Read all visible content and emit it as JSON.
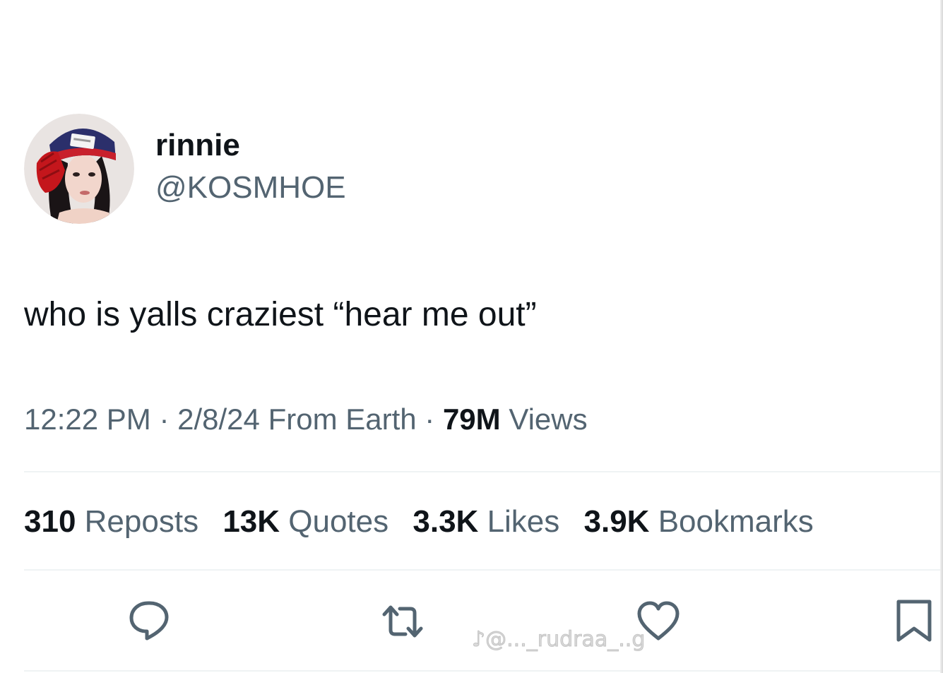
{
  "author": {
    "display_name": "rinnie",
    "handle": "@KOSMHOE"
  },
  "tweet": {
    "text": "who is yalls craziest “hear me out”"
  },
  "meta": {
    "time": "12:22 PM",
    "sep1": " · ",
    "date": "2/8/24",
    "source": "From Earth",
    "sep2": " · ",
    "views_count": "79M",
    "views_label": "Views"
  },
  "stats": [
    {
      "count": "310",
      "label": "Reposts"
    },
    {
      "count": "13K",
      "label": "Quotes"
    },
    {
      "count": "3.3K",
      "label": "Likes"
    },
    {
      "count": "3.9K",
      "label": "Bookmarks"
    }
  ],
  "actions": [
    {
      "name": "reply",
      "icon": "reply-icon"
    },
    {
      "name": "repost",
      "icon": "repost-icon"
    },
    {
      "name": "like",
      "icon": "heart-icon"
    },
    {
      "name": "bookmark",
      "icon": "bookmark-icon"
    }
  ],
  "watermark": "♪@..._rudraa_..g",
  "colors": {
    "primary_text": "#0f1419",
    "secondary_text": "#536471",
    "divider": "#eff3f4",
    "icon": "#536471"
  }
}
